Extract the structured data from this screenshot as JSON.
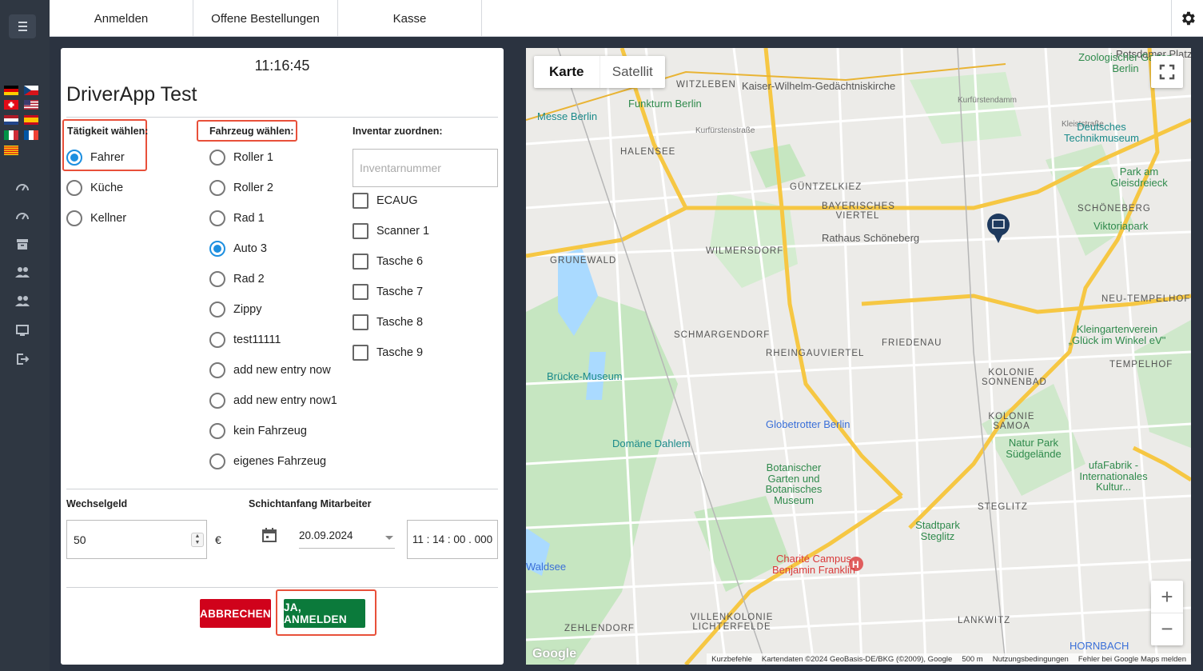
{
  "topbar": {
    "tabs": [
      "Anmelden",
      "Offene Bestellungen",
      "Kasse"
    ],
    "settings_icon": "gear-icon"
  },
  "sidebar": {
    "menu_icon": "hamburger-icon",
    "languages": [
      "de",
      "cz",
      "ch",
      "us",
      "nl",
      "es",
      "it",
      "fr",
      "ca"
    ],
    "items": [
      "dashboard-icon",
      "dashboard-icon",
      "archive-icon",
      "users-icon",
      "users-icon",
      "monitor-icon",
      "logout-icon"
    ]
  },
  "dialog": {
    "clock": "11:16:45",
    "title": "DriverApp Test",
    "activity": {
      "heading": "Tätigkeit wählen:",
      "options": [
        "Fahrer",
        "Küche",
        "Kellner"
      ],
      "selected": "Fahrer"
    },
    "vehicle": {
      "heading": "Fahrzeug wählen:",
      "options": [
        "Roller 1",
        "Roller 2",
        "Rad 1",
        "Auto 3",
        "Rad 2",
        "Zippy",
        "test11111",
        "add new entry now",
        "add new entry now1",
        "kein Fahrzeug",
        "eigenes Fahrzeug"
      ],
      "selected": "Auto 3"
    },
    "inventory": {
      "heading": "Inventar zuordnen:",
      "placeholder": "Inventarnummer",
      "items": [
        "ECAUG",
        "Scanner 1",
        "Tasche 6",
        "Tasche 7",
        "Tasche 8",
        "Tasche 9"
      ]
    },
    "change": {
      "label": "Wechselgeld",
      "value": "50",
      "currency": "€"
    },
    "shift": {
      "label": "Schichtanfang Mitarbeiter",
      "date": "20.09.2024",
      "time": "11 : 14 : 00 . 000"
    },
    "buttons": {
      "cancel": "ABBRECHEN",
      "confirm": "JA, ANMELDEN"
    },
    "colors": {
      "highlight": "#e8503a",
      "cancel": "#d0021b",
      "confirm": "#0b7a3b",
      "radio_on": "#1d8fe0"
    }
  },
  "map": {
    "types": [
      "Karte",
      "Satellit"
    ],
    "active_type": "Karte",
    "zoom_in": "+",
    "zoom_out": "−",
    "logo": "Google",
    "attribution": [
      "Kurzbefehle",
      "Kartendaten ©2024 GeoBasis-DE/BKG (©2009), Google",
      "500 m",
      "Nutzungsbedingungen",
      "Fehler bei Google Maps melden"
    ],
    "labels": [
      {
        "text": "Potsdamer Platz",
        "kind": "place"
      },
      {
        "text": "Zoologischer Garten Berlin",
        "kind": "poi-green"
      },
      {
        "text": "WITZLEBEN",
        "kind": "district"
      },
      {
        "text": "Kaiser-Wilhelm-Gedächtniskirche",
        "kind": "place"
      },
      {
        "text": "Funkturm Berlin",
        "kind": "poi-green"
      },
      {
        "text": "Messe Berlin",
        "kind": "poi-teal"
      },
      {
        "text": "Kurfürstenstraße",
        "kind": "street"
      },
      {
        "text": "Kleiststraße",
        "kind": "street"
      },
      {
        "text": "Kurfürstendamm",
        "kind": "street"
      },
      {
        "text": "Deutsches Technikmuseum",
        "kind": "poi-teal"
      },
      {
        "text": "HALENSEE",
        "kind": "district"
      },
      {
        "text": "Park am Gleisdreieck",
        "kind": "poi-green"
      },
      {
        "text": "GÜNTZELKIEZ",
        "kind": "district"
      },
      {
        "text": "WILMERSDORF",
        "kind": "district"
      },
      {
        "text": "BAYERISCHES VIERTEL",
        "kind": "district"
      },
      {
        "text": "SCHÖNEBERG",
        "kind": "district"
      },
      {
        "text": "Rathaus Schöneberg",
        "kind": "place"
      },
      {
        "text": "Viktoriapark",
        "kind": "poi-green"
      },
      {
        "text": "GRUNEWALD",
        "kind": "district"
      },
      {
        "text": "NEU-TEMPELHOF",
        "kind": "district"
      },
      {
        "text": "SCHMARGENDORF",
        "kind": "district"
      },
      {
        "text": "Kleingartenverein „Glück im Winkel eV\"",
        "kind": "poi-green"
      },
      {
        "text": "FRIEDENAU",
        "kind": "district"
      },
      {
        "text": "RHEINGAUVIERTEL",
        "kind": "district"
      },
      {
        "text": "Brücke-Museum",
        "kind": "poi-teal"
      },
      {
        "text": "KOLONIE SONNENBAD",
        "kind": "district"
      },
      {
        "text": "Globetrotter Berlin",
        "kind": "poi-blue"
      },
      {
        "text": "KOLONIE SAMOA",
        "kind": "district"
      },
      {
        "text": "Domäne Dahlem",
        "kind": "poi-teal"
      },
      {
        "text": "Natur Park Südgelände",
        "kind": "poi-green"
      },
      {
        "text": "ufaFabrik - Internationales Kultur...",
        "kind": "poi-green"
      },
      {
        "text": "Botanischer Garten und Botanisches Museum",
        "kind": "poi-green"
      },
      {
        "text": "STEGLITZ",
        "kind": "district"
      },
      {
        "text": "Stadtpark Steglitz",
        "kind": "poi-green"
      },
      {
        "text": "Charité Campus Benjamin Franklin",
        "kind": "poi-red"
      },
      {
        "text": "Waldsee",
        "kind": "poi-blue"
      },
      {
        "text": "VILLENKOLONIE LICHTERFELDE",
        "kind": "district"
      },
      {
        "text": "LANKWITZ",
        "kind": "district"
      },
      {
        "text": "ZEHLENDORF",
        "kind": "district"
      },
      {
        "text": "HORNBACH",
        "kind": "poi-blue"
      },
      {
        "text": "TEMPELHOF",
        "kind": "district"
      }
    ]
  }
}
